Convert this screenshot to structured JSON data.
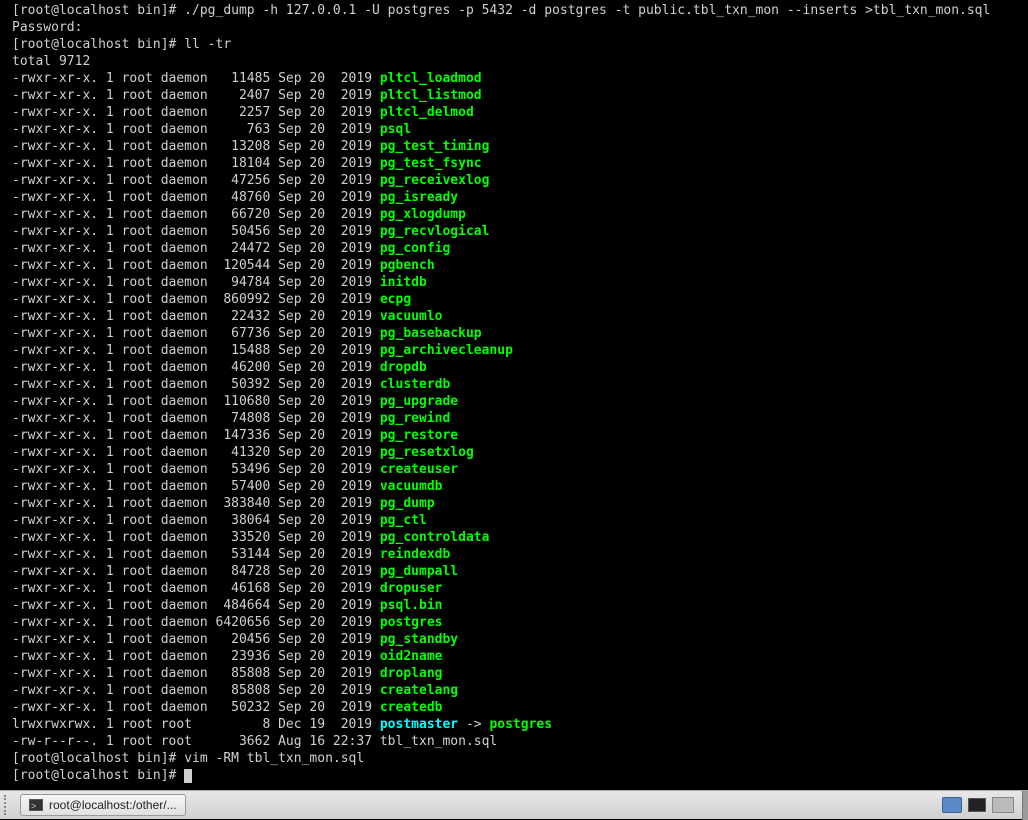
{
  "prompts": {
    "p1_prefix": "[root@localhost bin]# ",
    "p1_cmd": "./pg_dump -h 127.0.0.1 -U postgres -p 5432 -d postgres -t public.tbl_txn_mon --inserts >tbl_txn_mon.sql",
    "password": "Password:",
    "p2_prefix": "[root@localhost bin]# ",
    "p2_cmd": "ll -tr",
    "total": "total 9712",
    "p3_prefix": "[root@localhost bin]# ",
    "p3_cmd": "vim -RM tbl_txn_mon.sql",
    "p4_prefix": "[root@localhost bin]# "
  },
  "files": [
    {
      "perm": "-rwxr-xr-x.",
      "links": "1",
      "owner": "root",
      "group": "daemon",
      "size": "11485",
      "date": "Sep 20  2019",
      "name": "pltcl_loadmod",
      "type": "exec"
    },
    {
      "perm": "-rwxr-xr-x.",
      "links": "1",
      "owner": "root",
      "group": "daemon",
      "size": "2407",
      "date": "Sep 20  2019",
      "name": "pltcl_listmod",
      "type": "exec"
    },
    {
      "perm": "-rwxr-xr-x.",
      "links": "1",
      "owner": "root",
      "group": "daemon",
      "size": "2257",
      "date": "Sep 20  2019",
      "name": "pltcl_delmod",
      "type": "exec"
    },
    {
      "perm": "-rwxr-xr-x.",
      "links": "1",
      "owner": "root",
      "group": "daemon",
      "size": "763",
      "date": "Sep 20  2019",
      "name": "psql",
      "type": "exec"
    },
    {
      "perm": "-rwxr-xr-x.",
      "links": "1",
      "owner": "root",
      "group": "daemon",
      "size": "13208",
      "date": "Sep 20  2019",
      "name": "pg_test_timing",
      "type": "exec"
    },
    {
      "perm": "-rwxr-xr-x.",
      "links": "1",
      "owner": "root",
      "group": "daemon",
      "size": "18104",
      "date": "Sep 20  2019",
      "name": "pg_test_fsync",
      "type": "exec"
    },
    {
      "perm": "-rwxr-xr-x.",
      "links": "1",
      "owner": "root",
      "group": "daemon",
      "size": "47256",
      "date": "Sep 20  2019",
      "name": "pg_receivexlog",
      "type": "exec"
    },
    {
      "perm": "-rwxr-xr-x.",
      "links": "1",
      "owner": "root",
      "group": "daemon",
      "size": "48760",
      "date": "Sep 20  2019",
      "name": "pg_isready",
      "type": "exec"
    },
    {
      "perm": "-rwxr-xr-x.",
      "links": "1",
      "owner": "root",
      "group": "daemon",
      "size": "66720",
      "date": "Sep 20  2019",
      "name": "pg_xlogdump",
      "type": "exec"
    },
    {
      "perm": "-rwxr-xr-x.",
      "links": "1",
      "owner": "root",
      "group": "daemon",
      "size": "50456",
      "date": "Sep 20  2019",
      "name": "pg_recvlogical",
      "type": "exec"
    },
    {
      "perm": "-rwxr-xr-x.",
      "links": "1",
      "owner": "root",
      "group": "daemon",
      "size": "24472",
      "date": "Sep 20  2019",
      "name": "pg_config",
      "type": "exec"
    },
    {
      "perm": "-rwxr-xr-x.",
      "links": "1",
      "owner": "root",
      "group": "daemon",
      "size": "120544",
      "date": "Sep 20  2019",
      "name": "pgbench",
      "type": "exec"
    },
    {
      "perm": "-rwxr-xr-x.",
      "links": "1",
      "owner": "root",
      "group": "daemon",
      "size": "94784",
      "date": "Sep 20  2019",
      "name": "initdb",
      "type": "exec"
    },
    {
      "perm": "-rwxr-xr-x.",
      "links": "1",
      "owner": "root",
      "group": "daemon",
      "size": "860992",
      "date": "Sep 20  2019",
      "name": "ecpg",
      "type": "exec"
    },
    {
      "perm": "-rwxr-xr-x.",
      "links": "1",
      "owner": "root",
      "group": "daemon",
      "size": "22432",
      "date": "Sep 20  2019",
      "name": "vacuumlo",
      "type": "exec"
    },
    {
      "perm": "-rwxr-xr-x.",
      "links": "1",
      "owner": "root",
      "group": "daemon",
      "size": "67736",
      "date": "Sep 20  2019",
      "name": "pg_basebackup",
      "type": "exec"
    },
    {
      "perm": "-rwxr-xr-x.",
      "links": "1",
      "owner": "root",
      "group": "daemon",
      "size": "15488",
      "date": "Sep 20  2019",
      "name": "pg_archivecleanup",
      "type": "exec"
    },
    {
      "perm": "-rwxr-xr-x.",
      "links": "1",
      "owner": "root",
      "group": "daemon",
      "size": "46200",
      "date": "Sep 20  2019",
      "name": "dropdb",
      "type": "exec"
    },
    {
      "perm": "-rwxr-xr-x.",
      "links": "1",
      "owner": "root",
      "group": "daemon",
      "size": "50392",
      "date": "Sep 20  2019",
      "name": "clusterdb",
      "type": "exec"
    },
    {
      "perm": "-rwxr-xr-x.",
      "links": "1",
      "owner": "root",
      "group": "daemon",
      "size": "110680",
      "date": "Sep 20  2019",
      "name": "pg_upgrade",
      "type": "exec"
    },
    {
      "perm": "-rwxr-xr-x.",
      "links": "1",
      "owner": "root",
      "group": "daemon",
      "size": "74808",
      "date": "Sep 20  2019",
      "name": "pg_rewind",
      "type": "exec"
    },
    {
      "perm": "-rwxr-xr-x.",
      "links": "1",
      "owner": "root",
      "group": "daemon",
      "size": "147336",
      "date": "Sep 20  2019",
      "name": "pg_restore",
      "type": "exec"
    },
    {
      "perm": "-rwxr-xr-x.",
      "links": "1",
      "owner": "root",
      "group": "daemon",
      "size": "41320",
      "date": "Sep 20  2019",
      "name": "pg_resetxlog",
      "type": "exec"
    },
    {
      "perm": "-rwxr-xr-x.",
      "links": "1",
      "owner": "root",
      "group": "daemon",
      "size": "53496",
      "date": "Sep 20  2019",
      "name": "createuser",
      "type": "exec"
    },
    {
      "perm": "-rwxr-xr-x.",
      "links": "1",
      "owner": "root",
      "group": "daemon",
      "size": "57400",
      "date": "Sep 20  2019",
      "name": "vacuumdb",
      "type": "exec"
    },
    {
      "perm": "-rwxr-xr-x.",
      "links": "1",
      "owner": "root",
      "group": "daemon",
      "size": "383840",
      "date": "Sep 20  2019",
      "name": "pg_dump",
      "type": "exec"
    },
    {
      "perm": "-rwxr-xr-x.",
      "links": "1",
      "owner": "root",
      "group": "daemon",
      "size": "38064",
      "date": "Sep 20  2019",
      "name": "pg_ctl",
      "type": "exec"
    },
    {
      "perm": "-rwxr-xr-x.",
      "links": "1",
      "owner": "root",
      "group": "daemon",
      "size": "33520",
      "date": "Sep 20  2019",
      "name": "pg_controldata",
      "type": "exec"
    },
    {
      "perm": "-rwxr-xr-x.",
      "links": "1",
      "owner": "root",
      "group": "daemon",
      "size": "53144",
      "date": "Sep 20  2019",
      "name": "reindexdb",
      "type": "exec"
    },
    {
      "perm": "-rwxr-xr-x.",
      "links": "1",
      "owner": "root",
      "group": "daemon",
      "size": "84728",
      "date": "Sep 20  2019",
      "name": "pg_dumpall",
      "type": "exec"
    },
    {
      "perm": "-rwxr-xr-x.",
      "links": "1",
      "owner": "root",
      "group": "daemon",
      "size": "46168",
      "date": "Sep 20  2019",
      "name": "dropuser",
      "type": "exec"
    },
    {
      "perm": "-rwxr-xr-x.",
      "links": "1",
      "owner": "root",
      "group": "daemon",
      "size": "484664",
      "date": "Sep 20  2019",
      "name": "psql.bin",
      "type": "exec"
    },
    {
      "perm": "-rwxr-xr-x.",
      "links": "1",
      "owner": "root",
      "group": "daemon",
      "size": "6420656",
      "date": "Sep 20  2019",
      "name": "postgres",
      "type": "exec"
    },
    {
      "perm": "-rwxr-xr-x.",
      "links": "1",
      "owner": "root",
      "group": "daemon",
      "size": "20456",
      "date": "Sep 20  2019",
      "name": "pg_standby",
      "type": "exec"
    },
    {
      "perm": "-rwxr-xr-x.",
      "links": "1",
      "owner": "root",
      "group": "daemon",
      "size": "23936",
      "date": "Sep 20  2019",
      "name": "oid2name",
      "type": "exec"
    },
    {
      "perm": "-rwxr-xr-x.",
      "links": "1",
      "owner": "root",
      "group": "daemon",
      "size": "85808",
      "date": "Sep 20  2019",
      "name": "droplang",
      "type": "exec"
    },
    {
      "perm": "-rwxr-xr-x.",
      "links": "1",
      "owner": "root",
      "group": "daemon",
      "size": "85808",
      "date": "Sep 20  2019",
      "name": "createlang",
      "type": "exec"
    },
    {
      "perm": "-rwxr-xr-x.",
      "links": "1",
      "owner": "root",
      "group": "daemon",
      "size": "50232",
      "date": "Sep 20  2019",
      "name": "createdb",
      "type": "exec"
    },
    {
      "perm": "lrwxrwxrwx.",
      "links": "1",
      "owner": "root",
      "group": "root",
      "size": "8",
      "date": "Dec 19  2019",
      "name": "postmaster",
      "type": "link",
      "target": "postgres"
    },
    {
      "perm": "-rw-r--r--.",
      "links": "1",
      "owner": "root",
      "group": "root",
      "size": "3662",
      "date": "Aug 16 22:37",
      "name": "tbl_txn_mon.sql",
      "type": "normal"
    }
  ],
  "taskbar": {
    "app_label": "root@localhost:/other/..."
  }
}
